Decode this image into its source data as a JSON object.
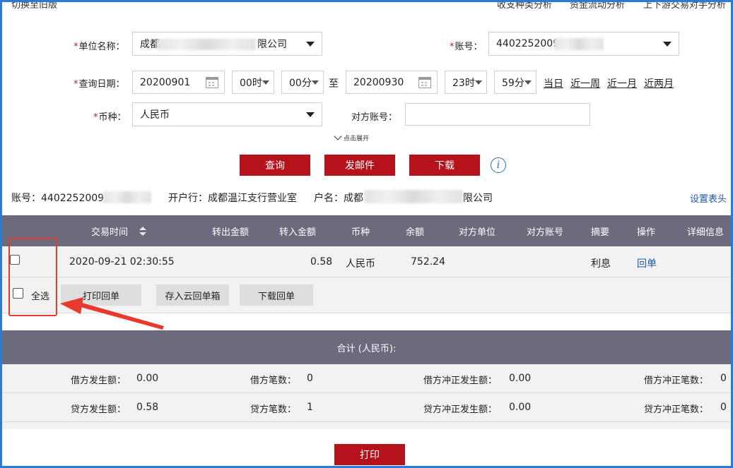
{
  "toplinks": {
    "switch_version": "切换至旧版",
    "income_analysis": "收支种类分析",
    "fund_flow": "资金流动分析",
    "counterparty": "上下游交易对手分析"
  },
  "form": {
    "unit_name_label": "单位名称：",
    "unit_name_value_start": "成都",
    "unit_name_value_end": "限公司",
    "account_label": "账号：",
    "account_value": "4402252009",
    "date_label": "查询日期：",
    "start_date": "20200901",
    "start_hour": "00时",
    "start_min": "00分",
    "to": "至",
    "end_date": "20200930",
    "end_hour": "23时",
    "end_min": "59分",
    "quick": [
      "当日",
      "近一周",
      "近一月",
      "近两月"
    ],
    "currency_label": "币种：",
    "currency_value": "人民币",
    "counter_account_label": "对方账号：",
    "counter_account_value": "",
    "expand": "点击展开"
  },
  "actions": {
    "query": "查询",
    "email": "发邮件",
    "download": "下载",
    "info": "i"
  },
  "account_info": {
    "account": "账号：44022520091",
    "bank": "开户行：成都温江支行营业室",
    "name_start": "户名：成都",
    "name_end": "限公司",
    "set_header": "设置表头"
  },
  "table": {
    "headers": [
      "交易时间",
      "转出金额",
      "转入金额",
      "币种",
      "余额",
      "对方单位",
      "对方账号",
      "摘要",
      "操作",
      "详细信息"
    ],
    "rows": [
      {
        "time": "2020-09-21  02:30:55",
        "out": "",
        "in": "0.58",
        "currency": "人民币",
        "balance": "752.24",
        "counter_unit": "",
        "counter_account": "",
        "summary": "利息",
        "op": "回单"
      }
    ],
    "select_all": "全选",
    "print_receipt": "打印回单",
    "save_cloud": "存入云回单箱",
    "download_receipt": "下载回单"
  },
  "summary": {
    "title": "合计 (人民币):",
    "debit_amount_label": "借方发生额：",
    "debit_amount": "0.00",
    "debit_count_label": "借方笔数：",
    "debit_count": "0",
    "debit_rev_amount_label": "借方冲正发生额：",
    "debit_rev_amount": "0.00",
    "debit_rev_count_label": "借方冲正笔数：",
    "debit_rev_count": "0",
    "credit_amount_label": "贷方发生额：",
    "credit_amount": "0.58",
    "credit_count_label": "贷方笔数：",
    "credit_count": "1",
    "credit_rev_amount_label": "贷方冲正发生额：",
    "credit_rev_amount": "0.00",
    "credit_rev_count_label": "贷方冲正笔数：",
    "credit_rev_count": "0"
  },
  "footer": {
    "print": "打印"
  },
  "colors": {
    "accent": "#b5121b",
    "header_bg": "#6b6b7d",
    "link": "#1f5aa8",
    "annotation": "#e83a2c",
    "frame": "#2a7bd6"
  }
}
